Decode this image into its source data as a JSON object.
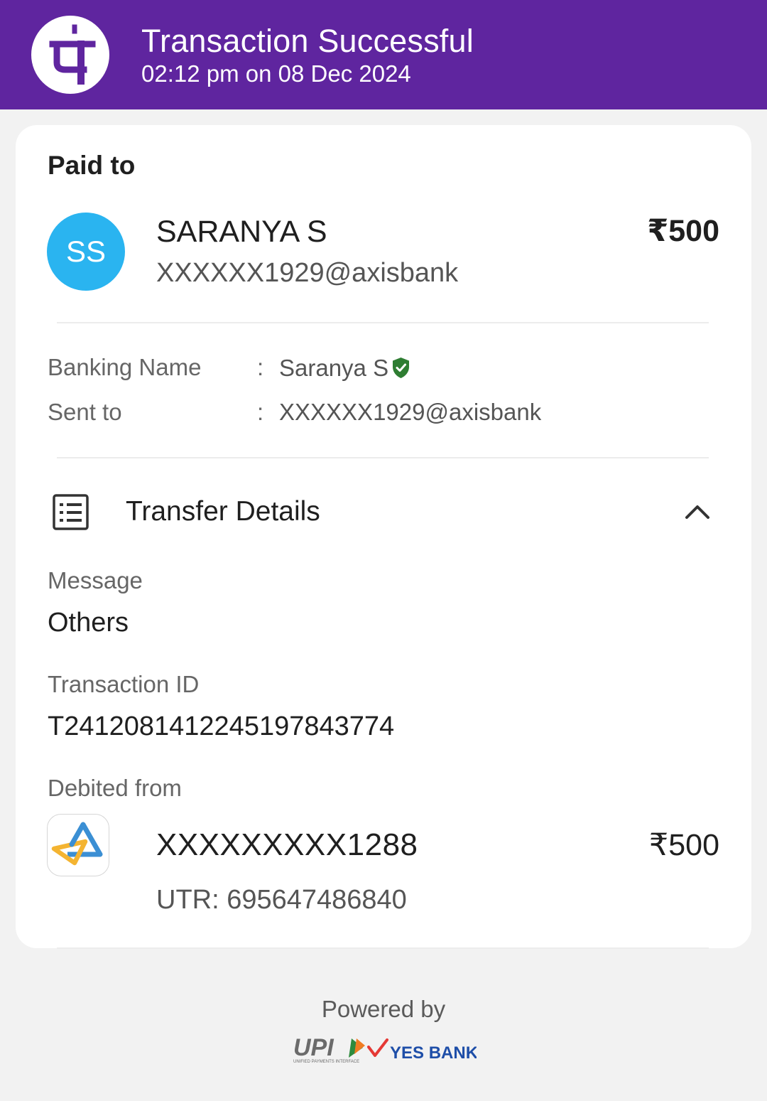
{
  "colors": {
    "header_bg": "#5f259f",
    "avatar_bg": "#2ab4f0",
    "verified_green": "#2e7d32",
    "page_bg": "#f2f2f2"
  },
  "header": {
    "logo_icon": "phonepe-logo-icon",
    "title": "Transaction Successful",
    "subtitle": "02:12 pm on 08 Dec 2024"
  },
  "paid_to": {
    "heading": "Paid to",
    "avatar_initials": "SS",
    "name": "SARANYA S",
    "vpa": "XXXXXX1929@axisbank",
    "amount": "₹500"
  },
  "details": {
    "banking_name_label": "Banking Name",
    "banking_name_value": "Saranya S",
    "verified_icon": "verified-shield-icon",
    "sent_to_label": "Sent to",
    "sent_to_value": "XXXXXX1929@axisbank",
    "separator": ":"
  },
  "transfer": {
    "title": "Transfer Details",
    "icon": "list-document-icon",
    "toggle_icon": "chevron-up-icon",
    "message_label": "Message",
    "message_value": "Others",
    "txn_id_label": "Transaction ID",
    "txn_id_value": "T2412081412245197843774",
    "debited_label": "Debited from",
    "bank_icon": "axis-bank-logo-icon",
    "account": "XXXXXXXXX1288",
    "utr": "UTR: 695647486840",
    "debit_amount": "₹500"
  },
  "footer": {
    "powered_by": "Powered by",
    "upi_logo": "UPI",
    "upi_tagline": "UNIFIED PAYMENTS INTERFACE",
    "bank_logo": "YES BANK"
  }
}
